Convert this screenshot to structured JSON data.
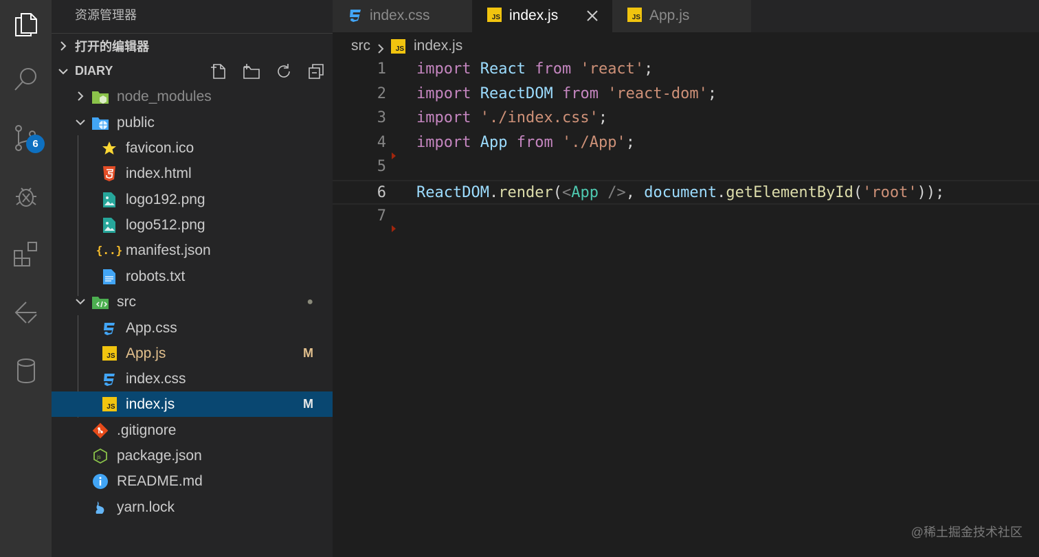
{
  "activity_bar": {
    "items": [
      {
        "name": "explorer-icon",
        "active": true
      },
      {
        "name": "search-icon",
        "active": false
      },
      {
        "name": "source-control-icon",
        "active": false,
        "badge": "6"
      },
      {
        "name": "debug-icon",
        "active": false
      },
      {
        "name": "extensions-icon",
        "active": false
      },
      {
        "name": "remote-icon",
        "active": false
      },
      {
        "name": "database-icon",
        "active": false
      }
    ]
  },
  "sidebar": {
    "title": "资源管理器",
    "open_editors_label": "打开的编辑器",
    "folder_label": "DIARY",
    "tree": [
      {
        "label": "node_modules",
        "kind": "folder",
        "expanded": false,
        "icon": "node-folder-icon"
      },
      {
        "label": "public",
        "kind": "folder",
        "expanded": true,
        "icon": "public-folder-icon"
      },
      {
        "label": "favicon.ico",
        "kind": "file",
        "icon": "star-icon"
      },
      {
        "label": "index.html",
        "kind": "file",
        "icon": "html5-icon"
      },
      {
        "label": "logo192.png",
        "kind": "file",
        "icon": "image-icon"
      },
      {
        "label": "logo512.png",
        "kind": "file",
        "icon": "image-icon"
      },
      {
        "label": "manifest.json",
        "kind": "file",
        "icon": "json-icon"
      },
      {
        "label": "robots.txt",
        "kind": "file",
        "icon": "text-file-icon"
      },
      {
        "label": "src",
        "kind": "folder",
        "expanded": true,
        "icon": "src-folder-icon",
        "status_dot": "●"
      },
      {
        "label": "App.css",
        "kind": "file",
        "icon": "css-icon"
      },
      {
        "label": "App.js",
        "kind": "file",
        "icon": "js-icon",
        "mark": "M"
      },
      {
        "label": "index.css",
        "kind": "file",
        "icon": "css-icon"
      },
      {
        "label": "index.js",
        "kind": "file",
        "icon": "js-icon",
        "mark": "M",
        "selected": true
      },
      {
        "label": ".gitignore",
        "kind": "file",
        "icon": "git-icon"
      },
      {
        "label": "package.json",
        "kind": "file",
        "icon": "nodejs-icon"
      },
      {
        "label": "README.md",
        "kind": "file",
        "icon": "info-icon"
      },
      {
        "label": "yarn.lock",
        "kind": "file",
        "icon": "yarn-icon"
      }
    ]
  },
  "tabs": [
    {
      "label": "index.css",
      "icon": "css-icon",
      "active": false
    },
    {
      "label": "index.js",
      "icon": "js-icon",
      "active": true
    },
    {
      "label": "App.js",
      "icon": "js-icon",
      "active": false
    }
  ],
  "js_badge_text": "JS",
  "breadcrumb": {
    "folder": "src",
    "file": "index.js"
  },
  "code": {
    "line_numbers": [
      "1",
      "2",
      "3",
      "4",
      "5",
      "6",
      "7"
    ],
    "lines": [
      [
        [
          "import",
          "kw"
        ],
        [
          " ",
          "pl"
        ],
        [
          "React",
          "var"
        ],
        [
          " ",
          "pl"
        ],
        [
          "from",
          "kw"
        ],
        [
          " ",
          "pl"
        ],
        [
          "'react'",
          "str"
        ],
        [
          ";",
          "pl"
        ]
      ],
      [
        [
          "import",
          "kw"
        ],
        [
          " ",
          "pl"
        ],
        [
          "ReactDOM",
          "var"
        ],
        [
          " ",
          "pl"
        ],
        [
          "from",
          "kw"
        ],
        [
          " ",
          "pl"
        ],
        [
          "'react-dom'",
          "str"
        ],
        [
          ";",
          "pl"
        ]
      ],
      [
        [
          "import",
          "kw"
        ],
        [
          " ",
          "pl"
        ],
        [
          "'./index.css'",
          "str"
        ],
        [
          ";",
          "pl"
        ]
      ],
      [
        [
          "import",
          "kw"
        ],
        [
          " ",
          "pl"
        ],
        [
          "App",
          "var"
        ],
        [
          " ",
          "pl"
        ],
        [
          "from",
          "kw"
        ],
        [
          " ",
          "pl"
        ],
        [
          "'./App'",
          "str"
        ],
        [
          ";",
          "pl"
        ]
      ],
      [],
      [
        [
          "ReactDOM",
          "var"
        ],
        [
          ".",
          "pl"
        ],
        [
          "render",
          "fn"
        ],
        [
          "(",
          "pl"
        ],
        [
          "<",
          "tag"
        ],
        [
          "App",
          "comp"
        ],
        [
          " />",
          "tag"
        ],
        [
          ", ",
          "pl"
        ],
        [
          "document",
          "var"
        ],
        [
          ".",
          "pl"
        ],
        [
          "getElementById",
          "fn"
        ],
        [
          "(",
          "pl"
        ],
        [
          "'root'",
          "str"
        ],
        [
          "));",
          "pl"
        ]
      ],
      []
    ],
    "current_line": 6
  },
  "colors": {
    "kw": "#c586c0",
    "var": "#9cdcfe",
    "str": "#ce9178",
    "fn": "#dcdcaa",
    "tag": "#808080",
    "comp": "#4ec9b0",
    "pl": "#d4d4d4"
  },
  "watermark": "@稀土掘金技术社区"
}
